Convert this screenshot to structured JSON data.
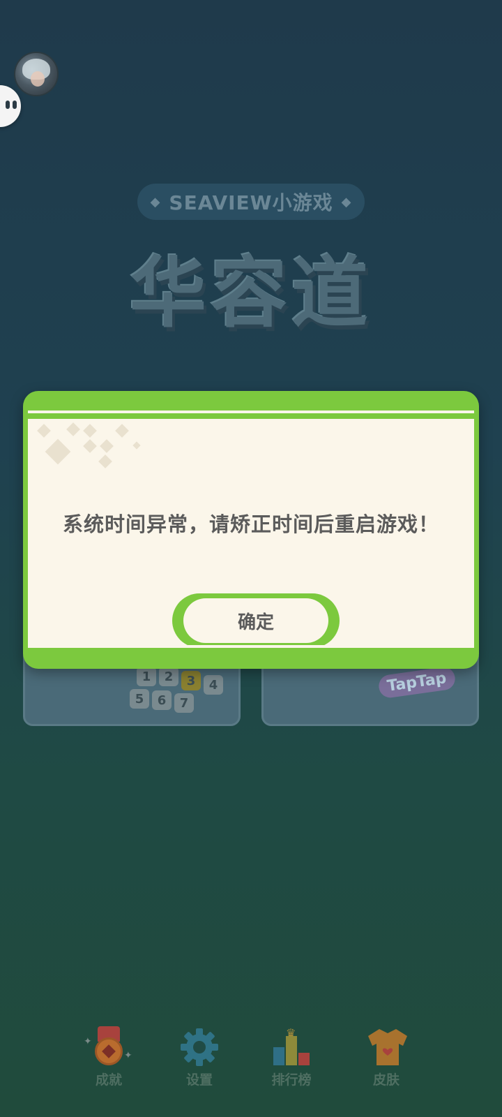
{
  "header": {
    "pill_text": "SEAVIEW小游戏",
    "pill_left_symbol": "◆",
    "pill_right_symbol": "◆",
    "title": "华容道"
  },
  "icons": {
    "avatar": "user-avatar",
    "floating": "floating-assistant-icon"
  },
  "cards": {
    "left_tiles": [
      "1",
      "2",
      "3",
      "4",
      "5",
      "6",
      "7"
    ],
    "right_logo": "TapTap"
  },
  "dialog": {
    "message": "系统时间异常，请矫正时间后重启游戏！",
    "confirm_label": "确定"
  },
  "nav": [
    {
      "label": "成就",
      "icon": "medal-icon"
    },
    {
      "label": "设置",
      "icon": "gear-icon"
    },
    {
      "label": "排行榜",
      "icon": "leaderboard-icon"
    },
    {
      "label": "皮肤",
      "icon": "shirt-icon"
    }
  ],
  "colors": {
    "accent_green": "#7cc93e",
    "dialog_bg": "#fbf6ea",
    "text_dark": "#5b5b5b"
  }
}
